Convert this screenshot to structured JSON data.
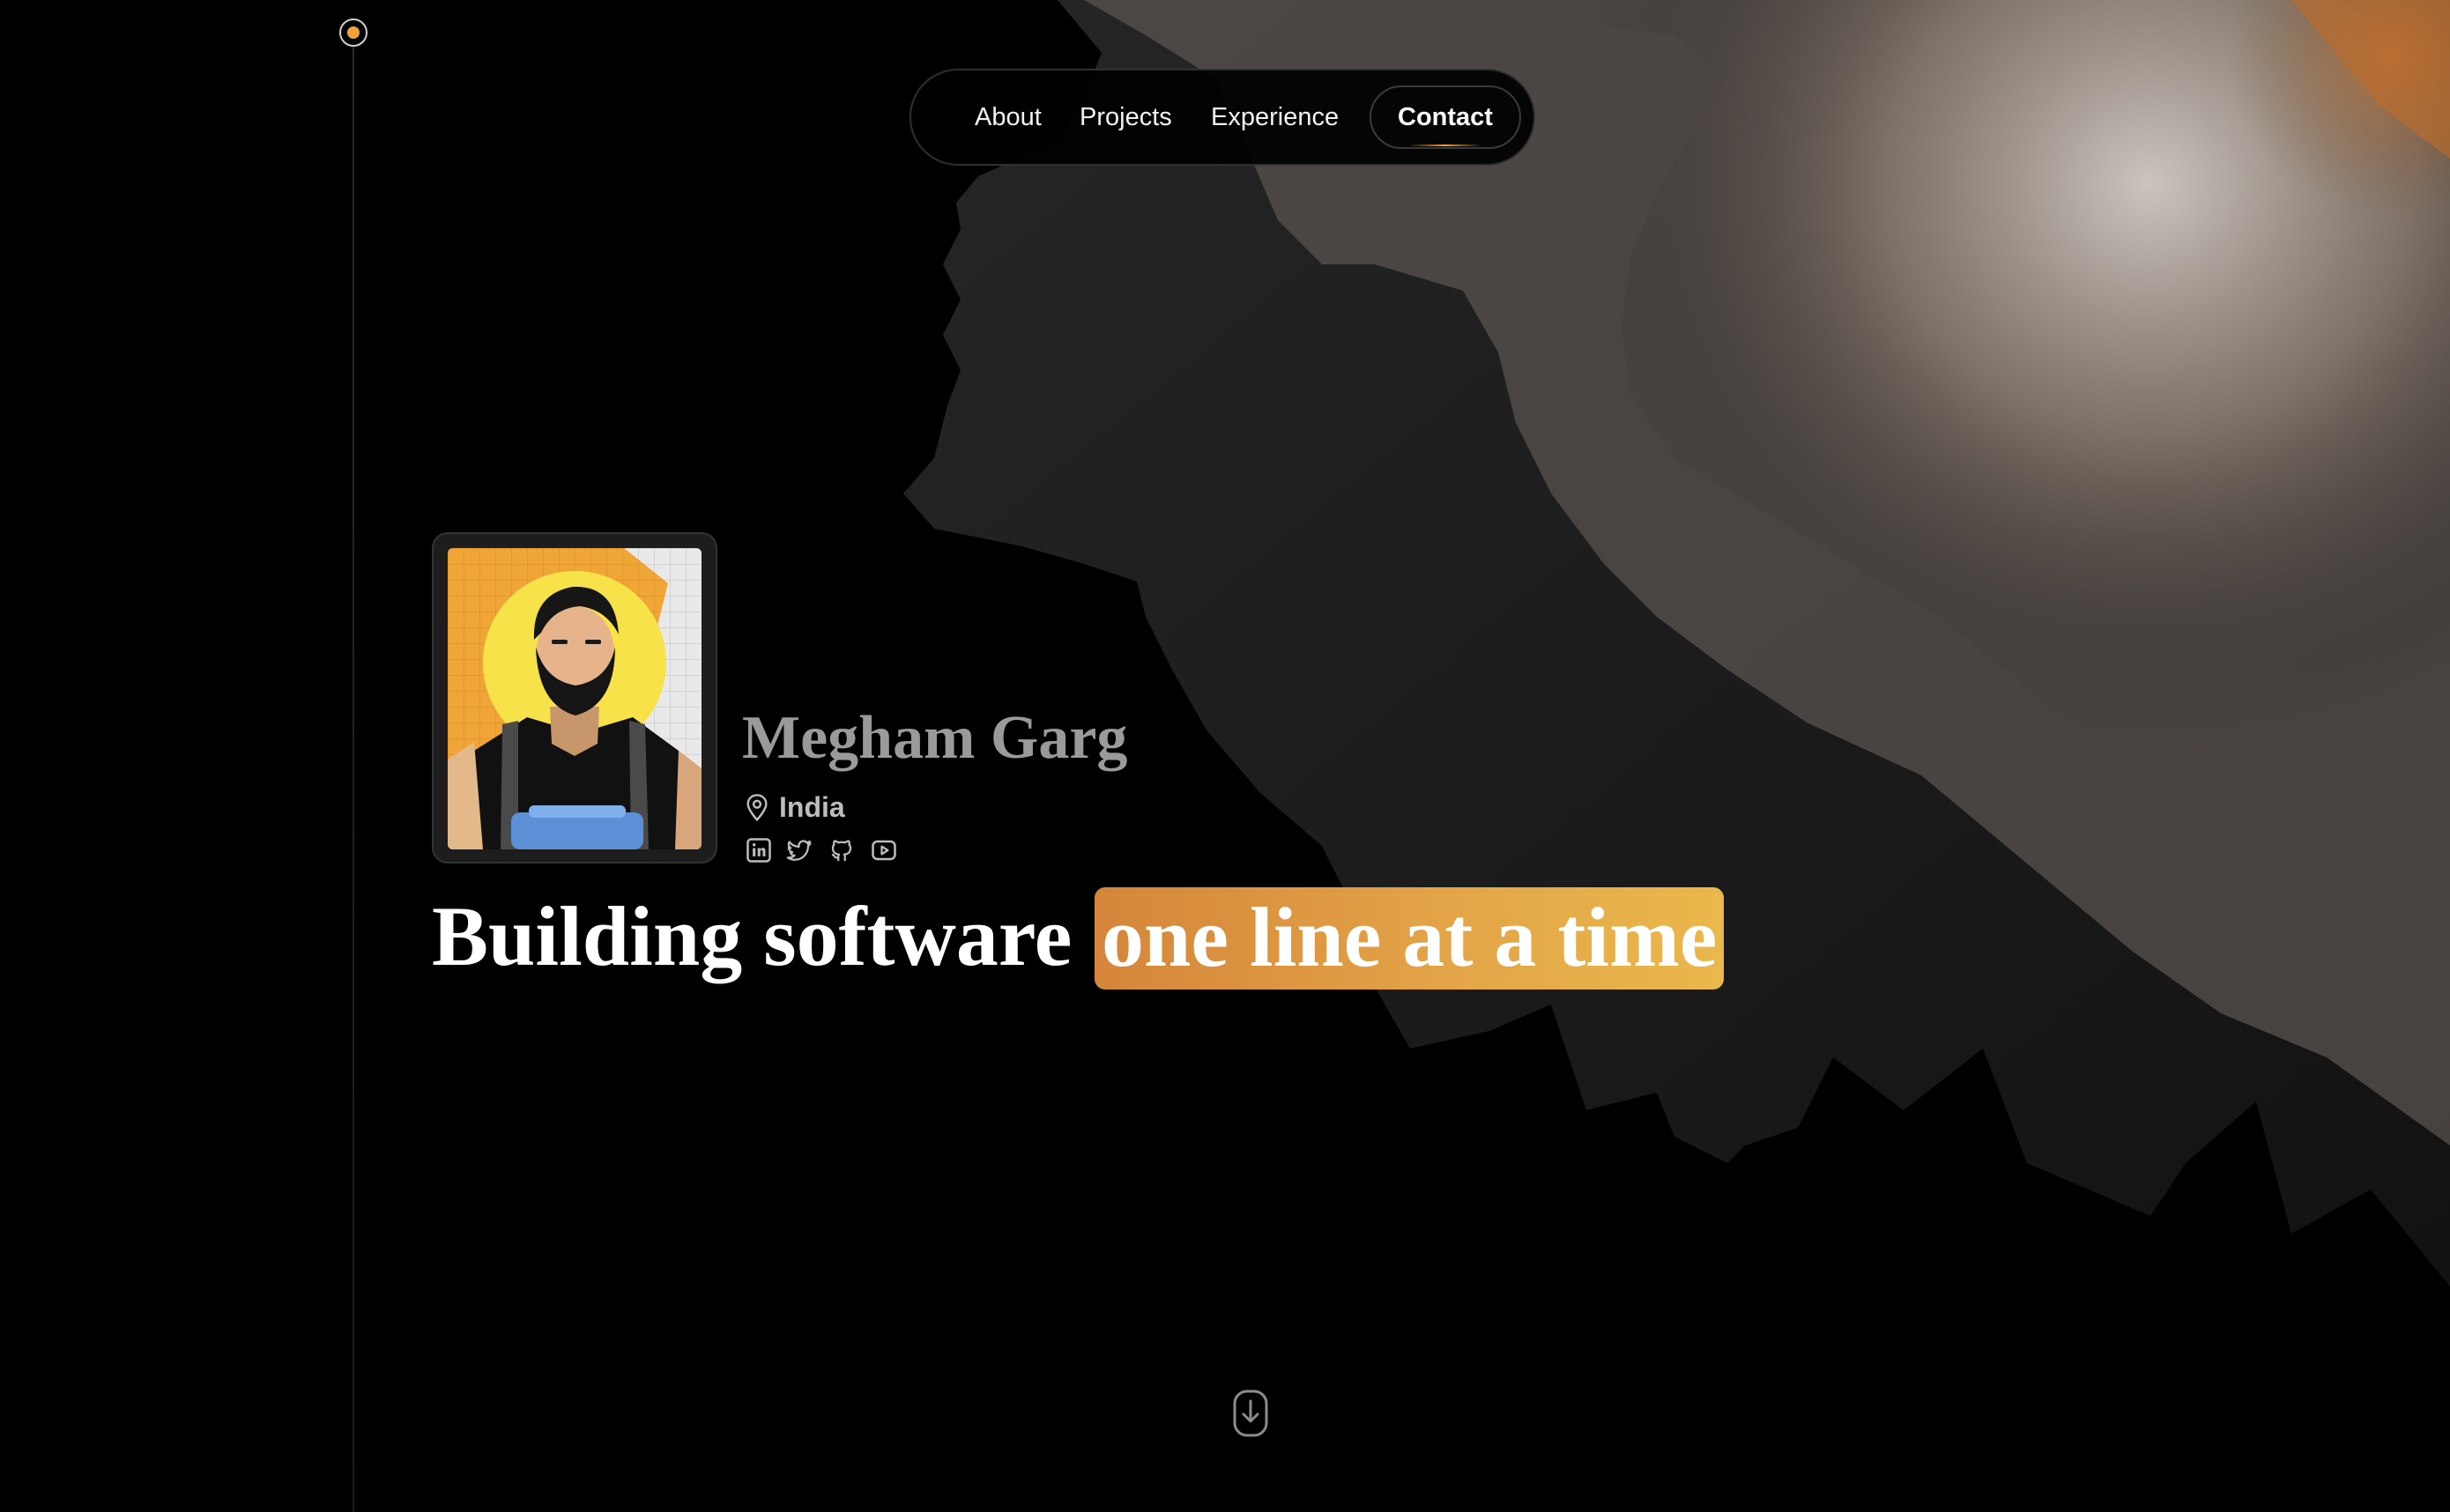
{
  "timeline": {
    "dot_color": "#f0a338"
  },
  "nav": {
    "items": [
      {
        "label": "About"
      },
      {
        "label": "Projects"
      },
      {
        "label": "Experience"
      }
    ],
    "cta_label": "Contact"
  },
  "profile": {
    "name": "Megham Garg",
    "location": "India",
    "location_icon": "map-pin-icon",
    "socials": [
      {
        "icon": "linkedin-icon"
      },
      {
        "icon": "twitter-icon"
      },
      {
        "icon": "github-icon"
      },
      {
        "icon": "youtube-icon"
      }
    ]
  },
  "hero": {
    "headline_plain": "Building software",
    "headline_highlight": "one line at a time",
    "highlight_colors": [
      "#d5853a",
      "#eab84c"
    ]
  },
  "scroll_hint": {
    "icon": "scroll-down-icon"
  }
}
